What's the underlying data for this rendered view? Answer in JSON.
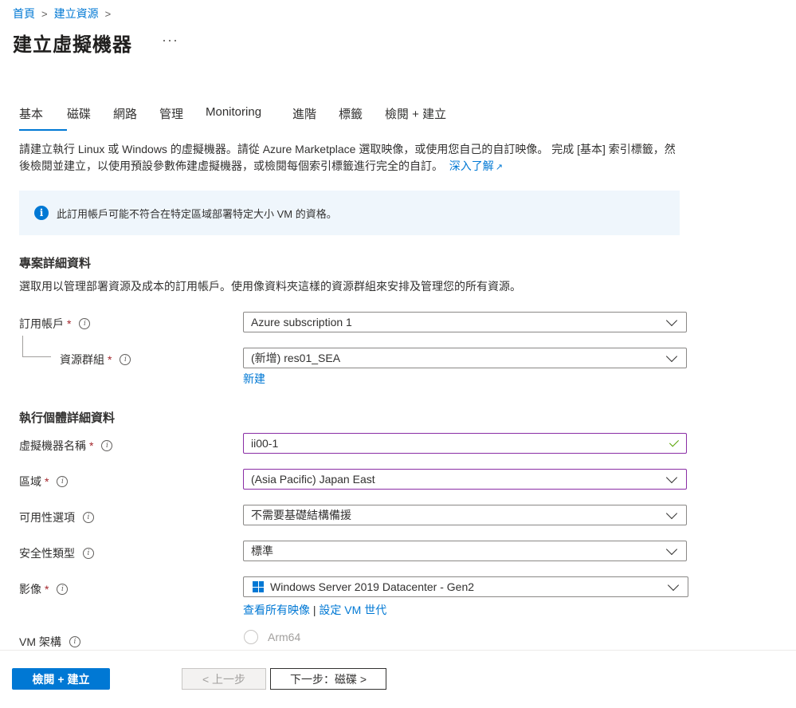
{
  "breadcrumb": {
    "home": "首頁",
    "create": "建立資源",
    "sep": ">"
  },
  "page": {
    "title": "建立虛擬機器",
    "more": "···"
  },
  "tabs": [
    "基本",
    "磁碟",
    "網路",
    "管理",
    "Monitoring",
    "進階",
    "標籤",
    "檢閱 + 建立"
  ],
  "intro": {
    "text": "請建立執行 Linux 或 Windows 的虛擬機器。請從 Azure Marketplace 選取映像，或使用您自己的自訂映像。 完成 [基本] 索引標籤，然後檢閱並建立，以使用預設參數佈建虛擬機器，或檢閱每個索引標籤進行完全的自訂。",
    "learn_more": "深入了解",
    "learn_more_icon": "external-link-icon"
  },
  "info_banner": {
    "icon": "info-icon",
    "text": "此訂用帳戶可能不符合在特定區域部署特定大小 VM 的資格。"
  },
  "project": {
    "title": "專案詳細資料",
    "desc": "選取用以管理部署資源及成本的訂用帳戶。使用像資料夾這樣的資源群組來安排及管理您的所有資源。",
    "subscription_label": "訂用帳戶",
    "subscription_value": "Azure subscription 1",
    "rg_label": "資源群組",
    "rg_value": "(新增) res01_SEA",
    "rg_new": "新建"
  },
  "instance": {
    "title": "執行個體詳細資料",
    "vm_name_label": "虛擬機器名稱",
    "vm_name_value": "ii00-1",
    "region_label": "區域",
    "region_value": "(Asia Pacific) Japan East",
    "avail_label": "可用性選項",
    "avail_value": "不需要基礎結構備援",
    "security_label": "安全性類型",
    "security_value": "標準",
    "image_label": "影像",
    "image_value": "Windows Server 2019 Datacenter - Gen2",
    "image_link1": "查看所有映像",
    "image_link_sep": "|",
    "image_link2": "設定 VM 世代",
    "arch_label": "VM 架構",
    "arch_option": "Arm64"
  },
  "markers": {
    "required": "*",
    "tip": "i"
  },
  "footer": {
    "review": "檢閱 + 建立",
    "prev": "< 上一步",
    "next": "下一步：磁碟 >"
  },
  "colors": {
    "accent": "#0078d4",
    "required": "#a4262c",
    "focus_border": "#8a2da5",
    "valid": "#57a300",
    "info_bg": "#eff6fc"
  }
}
